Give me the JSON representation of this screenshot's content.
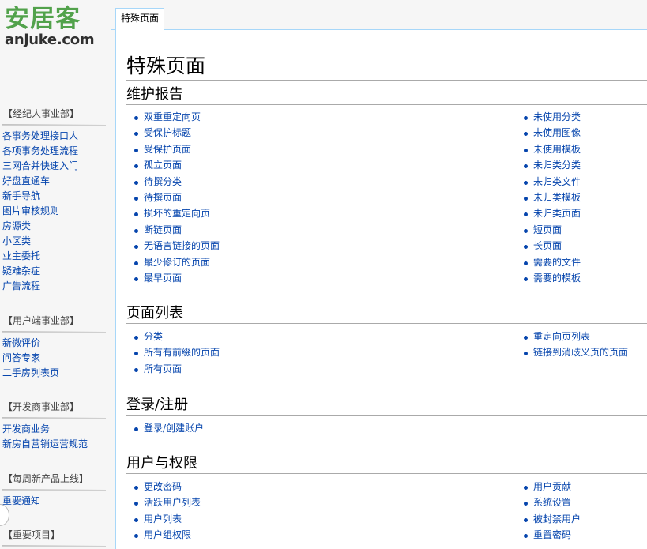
{
  "logo": {
    "cn": "安居客",
    "en": "anjuke.com"
  },
  "tab": {
    "label": "特殊页面"
  },
  "page": {
    "title": "特殊页面"
  },
  "sidebar": [
    {
      "heading": "【经纪人事业部】",
      "items": [
        "各事务处理接口人",
        "各项事务处理流程",
        "三网合并快速入门",
        "好盘直通车",
        "新手导航",
        "图片审核规则",
        "房源类",
        "小区类",
        "业主委托",
        "疑难杂症",
        "广告流程"
      ]
    },
    {
      "heading": "【用户端事业部】",
      "items": [
        "新微评价",
        "问答专家",
        "二手房列表页"
      ]
    },
    {
      "heading": "【开发商事业部】",
      "items": [
        "开发商业务",
        "新房自营销运营规范"
      ]
    },
    {
      "heading": "【每周新产品上线】",
      "items": [
        "重要通知"
      ]
    },
    {
      "heading": "【重要项目】",
      "items": []
    }
  ],
  "sections": [
    {
      "title": "维护报告",
      "left": [
        "双重重定向页",
        "受保护标题",
        "受保护页面",
        "孤立页面",
        "待撰分类",
        "待撰页面",
        "损坏的重定向页",
        "断链页面",
        "无语言链接的页面",
        "最少修订的页面",
        "最早页面"
      ],
      "right": [
        "未使用分类",
        "未使用图像",
        "未使用模板",
        "未归类分类",
        "未归类文件",
        "未归类模板",
        "未归类页面",
        "短页面",
        "长页面",
        "需要的文件",
        "需要的模板"
      ]
    },
    {
      "title": "页面列表",
      "left": [
        "分类",
        "所有有前缀的页面",
        "所有页面"
      ],
      "right": [
        "重定向页列表",
        "链接到消歧义页的页面"
      ]
    },
    {
      "title": "登录/注册",
      "left": [
        "登录/创建账户"
      ],
      "right": []
    },
    {
      "title": "用户与权限",
      "left": [
        "更改密码",
        "活跃用户列表",
        "用户列表",
        "用户组权限"
      ],
      "right": [
        "用户贡献",
        "系统设置",
        "被封禁用户",
        "重置密码"
      ]
    }
  ]
}
